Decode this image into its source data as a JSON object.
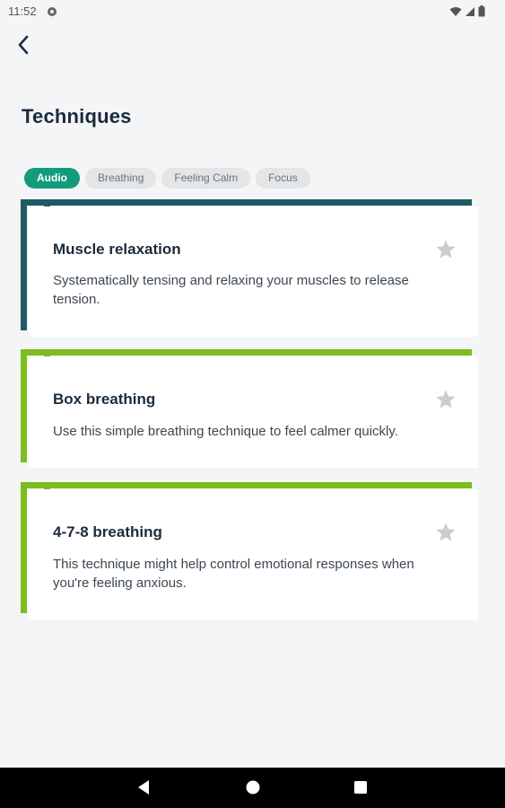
{
  "status": {
    "time": "11:52"
  },
  "header": {
    "title": "Techniques"
  },
  "filters": [
    {
      "label": "Audio",
      "active": true
    },
    {
      "label": "Breathing",
      "active": false
    },
    {
      "label": "Feeling Calm",
      "active": false
    },
    {
      "label": "Focus",
      "active": false
    }
  ],
  "cards": [
    {
      "title": "Muscle relaxation",
      "description": "Systematically tensing and relaxing your muscles to release tension.",
      "accent_color": "#1e5a63",
      "starred": false
    },
    {
      "title": "Box breathing",
      "description": "Use this simple breathing technique to feel calmer quickly.",
      "accent_color": "#7dbb1f",
      "starred": false
    },
    {
      "title": "4-7-8 breathing",
      "description": "This technique might help control emotional responses when you're feeling anxious.",
      "accent_color": "#7dbb1f",
      "starred": false
    }
  ],
  "colors": {
    "chip_active": "#139b7c",
    "background": "#f4f5f7"
  },
  "icons": {
    "back": "chevron-left-icon",
    "star": "star-icon",
    "nav": [
      "back-triangle-icon",
      "home-circle-icon",
      "recents-square-icon"
    ]
  }
}
